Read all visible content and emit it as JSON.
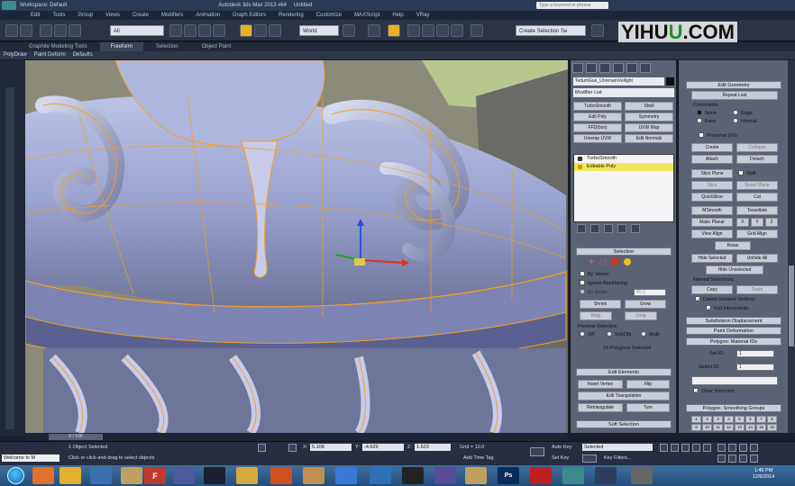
{
  "title_bar": {
    "workspace": "Workspace: Default",
    "app_title": "Autodesk 3ds Max  2013 x64",
    "file": "Untitled",
    "search_placeholder": "Type a keyword or phrase"
  },
  "menu": [
    "Edit",
    "Tools",
    "Group",
    "Views",
    "Create",
    "Modifiers",
    "Animation",
    "Graph Editors",
    "Rendering",
    "Customize",
    "MAXScript",
    "Help",
    "VRay"
  ],
  "watermark": {
    "a": "YIHU",
    "b": "U",
    "c": ".COM"
  },
  "toolbar": {
    "selection_filter": "All",
    "coord_system": "World",
    "named_selection": "Create Selection Se"
  },
  "ribbon": {
    "tabs": [
      "Graphite Modeling Tools",
      "Freeform",
      "Selection",
      "Object Paint"
    ],
    "active_tab": 1,
    "sub": [
      "PolyDraw",
      "Paint Deform",
      "Defaults"
    ]
  },
  "command_panel": {
    "object_name": "TedumGue_UnrenamVellight",
    "modifier_list": "Modifier List",
    "buttons": [
      "TurboSmooth",
      "Shell",
      "Edit Poly",
      "Symmetry",
      "FFD(box)",
      "UVW Map",
      "Unwrap UVW",
      "Edit Normals"
    ],
    "stack": [
      "TurboSmooth",
      "Editable Poly"
    ],
    "selection_title": "Selection",
    "by_vertex": "By Vertex",
    "ignore_backfacing": "Ignore Backfacing",
    "by_angle": "By Angle:",
    "by_angle_value": "45.0",
    "shrink": "Shrink",
    "grow": "Grow",
    "ring": "Ring",
    "loop": "Loop",
    "preview_selection": "Preview Selection",
    "off": "Off",
    "subobj": "SubObj",
    "multi": "Multi",
    "selected_info": "24 Polygons Selected",
    "edit_elements": "Edit Elements",
    "insert_vertex": "Insert Vertex",
    "flip": "Flip",
    "edit_triangulation": "Edit Triangulation",
    "retriangulate": "Retriangulate",
    "turn": "Turn",
    "soft_selection": "Soft Selection"
  },
  "right_panel": {
    "edit_geometry": "Edit Geometry",
    "repeat_last": "Repeat Last",
    "constraints": "Constraints",
    "none": "None",
    "edge": "Edge",
    "face": "Face",
    "normal": "Normal",
    "preserve_uvs": "Preserve UVs",
    "create": "Create",
    "collapse": "Collapse",
    "attach": "Attach",
    "detach": "Detach",
    "slice_plane": "Slice Plane",
    "split": "Split",
    "slice": "Slice",
    "reset_plane": "Reset Plane",
    "quickslice": "QuickSlice",
    "cut": "Cut",
    "msmooth": "MSmooth",
    "tessellate": "Tessellate",
    "make_planar": "Make Planar",
    "xyz": [
      "X",
      "Y",
      "Z"
    ],
    "view_align": "View Align",
    "grid_align": "Grid Align",
    "relax": "Relax",
    "hide_selected": "Hide Selected",
    "unhide_all": "Unhide All",
    "hide_unselected": "Hide Unselected",
    "named_selections": "Named Selections:",
    "copy": "Copy",
    "paste": "Paste",
    "delete_isolated": "Delete Isolated Vertices",
    "full_interactivity": "Full Interactivity",
    "subdivision_displacement": "Subdivision Displacement",
    "paint_deformation": "Paint Deformation",
    "polygon_material_ids": "Polygon: Material IDs",
    "set_id": "Set ID:",
    "select_id": "Select ID",
    "set_id_value": "1",
    "select_id_value": "1",
    "clear_selection": "Clear Selection",
    "smoothing_groups": "Polygon: Smoothing Groups",
    "sg_numbers": [
      "1",
      "2",
      "3",
      "4",
      "5",
      "6",
      "7",
      "8",
      "9",
      "10",
      "11",
      "12",
      "13",
      "14",
      "15",
      "16"
    ]
  },
  "status": {
    "time": "0 / 100",
    "objects_selected": "1 Object Selected",
    "prompt": "Click or click-and-drag to select objects",
    "x": "5.108",
    "y": "-4.629",
    "z": "1.623",
    "grid": "Grid = 10.0",
    "add_time_tag": "Add Time Tag",
    "auto_key": "Auto Key",
    "set_key": "Set Key",
    "key_filter_value": "Selected",
    "key_filters": "Key Filters...",
    "welcome": "Welcome  to  M"
  },
  "taskbar": {
    "time": "1:45 PM",
    "date": "12/6/2014"
  },
  "colors": {
    "selection_orange": "#f0a020",
    "stack_highlight": "#f2e65a",
    "mesh_surface": "#a6aed8"
  }
}
